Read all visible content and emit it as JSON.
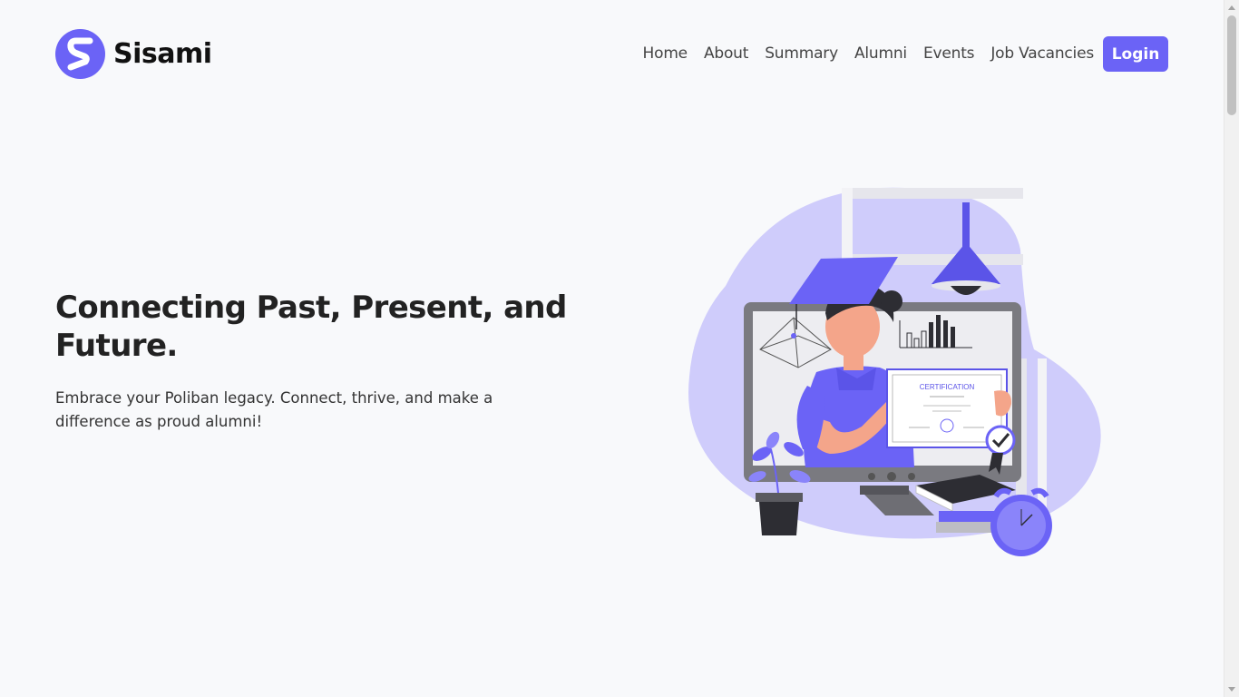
{
  "brand": {
    "name": "Sisami",
    "accent": "#6b63f6"
  },
  "nav": {
    "items": [
      {
        "label": "Home"
      },
      {
        "label": "About"
      },
      {
        "label": "Summary"
      },
      {
        "label": "Alumni"
      },
      {
        "label": "Events"
      },
      {
        "label": "Job Vacancies"
      }
    ],
    "login_label": "Login"
  },
  "hero": {
    "title": "Connecting Past, Present, and Future.",
    "subtitle": "Embrace your Poliban legacy. Connect, thrive, and make a difference as proud alumni!"
  },
  "illustration": {
    "certificate_label": "CERTIFICATION"
  }
}
